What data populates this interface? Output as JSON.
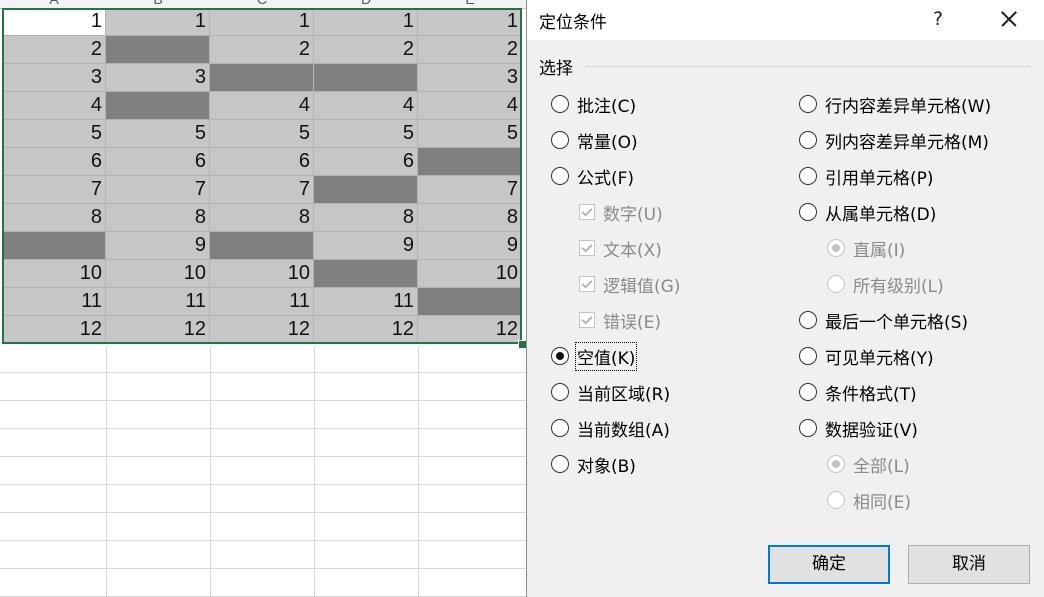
{
  "sheet": {
    "columns": [
      "A",
      "B",
      "C",
      "D",
      "E"
    ],
    "rows": [
      [
        "1",
        "1",
        "1",
        "1",
        "1"
      ],
      [
        "2",
        "",
        "2",
        "2",
        "2"
      ],
      [
        "3",
        "3",
        "",
        "",
        "3"
      ],
      [
        "4",
        "",
        "4",
        "4",
        "4"
      ],
      [
        "5",
        "5",
        "5",
        "5",
        "5"
      ],
      [
        "6",
        "6",
        "6",
        "6",
        ""
      ],
      [
        "7",
        "7",
        "7",
        "",
        "7"
      ],
      [
        "8",
        "8",
        "8",
        "8",
        "8"
      ],
      [
        "",
        "9",
        "",
        "9",
        "9"
      ],
      [
        "10",
        "10",
        "10",
        "",
        "10"
      ],
      [
        "11",
        "11",
        "11",
        "11",
        ""
      ],
      [
        "12",
        "12",
        "12",
        "12",
        "12"
      ]
    ],
    "selection_color": "#217346"
  },
  "dialog": {
    "title": "定位条件",
    "help_label": "?",
    "group_label": "选择",
    "left_options": [
      {
        "label": "批注(C)",
        "control": "radio",
        "checked": false,
        "disabled": false
      },
      {
        "label": "常量(O)",
        "control": "radio",
        "checked": false,
        "disabled": false
      },
      {
        "label": "公式(F)",
        "control": "radio",
        "checked": false,
        "disabled": false
      },
      {
        "label": "数字(U)",
        "control": "checkbox",
        "checked": true,
        "disabled": true
      },
      {
        "label": "文本(X)",
        "control": "checkbox",
        "checked": true,
        "disabled": true
      },
      {
        "label": "逻辑值(G)",
        "control": "checkbox",
        "checked": true,
        "disabled": true
      },
      {
        "label": "错误(E)",
        "control": "checkbox",
        "checked": true,
        "disabled": true
      },
      {
        "label": "空值(K)",
        "control": "radio",
        "checked": true,
        "disabled": false
      },
      {
        "label": "当前区域(R)",
        "control": "radio",
        "checked": false,
        "disabled": false
      },
      {
        "label": "当前数组(A)",
        "control": "radio",
        "checked": false,
        "disabled": false
      },
      {
        "label": "对象(B)",
        "control": "radio",
        "checked": false,
        "disabled": false
      }
    ],
    "right_options": [
      {
        "label": "行内容差异单元格(W)",
        "control": "radio",
        "checked": false,
        "disabled": false
      },
      {
        "label": "列内容差异单元格(M)",
        "control": "radio",
        "checked": false,
        "disabled": false
      },
      {
        "label": "引用单元格(P)",
        "control": "radio",
        "checked": false,
        "disabled": false
      },
      {
        "label": "从属单元格(D)",
        "control": "radio",
        "checked": false,
        "disabled": false
      },
      {
        "label": "直属(I)",
        "control": "radio",
        "checked": true,
        "disabled": true
      },
      {
        "label": "所有级别(L)",
        "control": "radio",
        "checked": false,
        "disabled": true
      },
      {
        "label": "最后一个单元格(S)",
        "control": "radio",
        "checked": false,
        "disabled": false
      },
      {
        "label": "可见单元格(Y)",
        "control": "radio",
        "checked": false,
        "disabled": false
      },
      {
        "label": "条件格式(T)",
        "control": "radio",
        "checked": false,
        "disabled": false
      },
      {
        "label": "数据验证(V)",
        "control": "radio",
        "checked": false,
        "disabled": false
      },
      {
        "label": "全部(L)",
        "control": "radio",
        "checked": true,
        "disabled": true
      },
      {
        "label": "相同(E)",
        "control": "radio",
        "checked": false,
        "disabled": true
      }
    ],
    "ok_label": "确定",
    "cancel_label": "取消"
  }
}
